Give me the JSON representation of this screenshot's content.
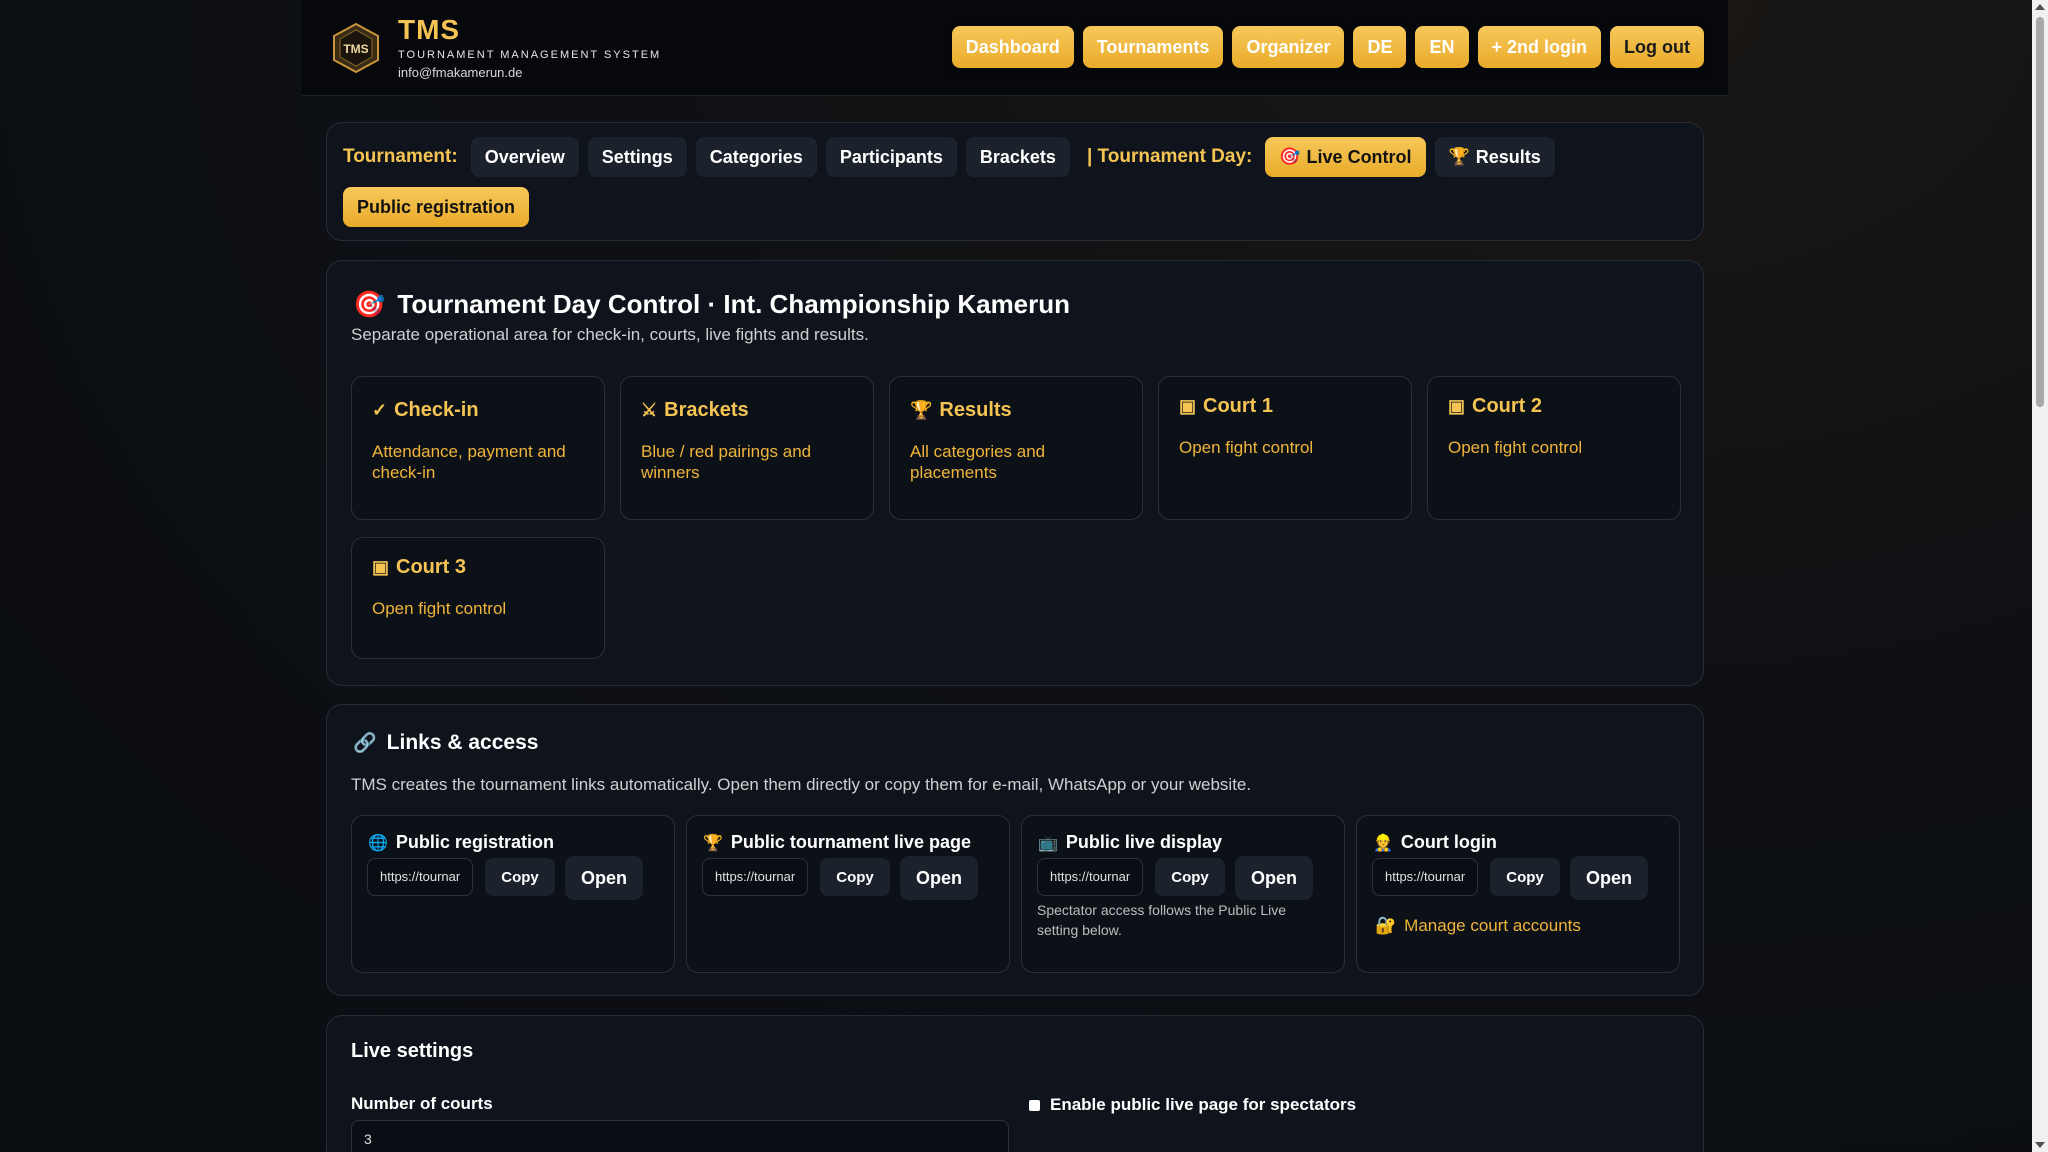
{
  "header": {
    "title": "TMS",
    "subtitle": "TOURNAMENT MANAGEMENT SYSTEM",
    "email": "info@fmakamerun.de",
    "logo_text": "TMS",
    "nav": [
      "Dashboard",
      "Tournaments",
      "Organizer",
      "DE",
      "EN",
      "+ 2nd login",
      "Log out"
    ]
  },
  "tabs": {
    "tournament_label": "Tournament:",
    "tournament_tabs": [
      "Overview",
      "Settings",
      "Categories",
      "Participants",
      "Brackets"
    ],
    "day_label": "| Tournament Day:",
    "live_control": "Live Control",
    "results": "Results",
    "public_registration": "Public registration"
  },
  "control": {
    "title": "Tournament Day Control · Int. Championship Kamerun",
    "subtitle": "Separate operational area for check-in, courts, live fights and results.",
    "cards": [
      {
        "icon": "check-icon",
        "title": "Check-in",
        "desc": "Attendance, payment and check-in"
      },
      {
        "icon": "swords-icon",
        "title": "Brackets",
        "desc": "Blue / red pairings and winners"
      },
      {
        "icon": "trophy-icon",
        "title": "Results",
        "desc": "All categories and placements"
      },
      {
        "icon": "court-icon",
        "title": "Court 1",
        "desc": "Open fight control"
      },
      {
        "icon": "court-icon",
        "title": "Court 2",
        "desc": "Open fight control"
      },
      {
        "icon": "court-icon",
        "title": "Court 3",
        "desc": "Open fight control"
      }
    ]
  },
  "links": {
    "title": "Links & access",
    "desc": "TMS creates the tournament links automatically. Open them directly or copy them for e-mail, WhatsApp or your website.",
    "copy_label": "Copy",
    "open_label": "Open",
    "cards": [
      {
        "icon": "globe-icon",
        "title": "Public registration",
        "url": "https://tournament"
      },
      {
        "icon": "trophy-icon",
        "title": "Public tournament live page",
        "url": "https://tournament"
      },
      {
        "icon": "tv-icon",
        "title": "Public live display",
        "url": "https://tournament",
        "note": "Spectator access follows the Public Live setting below."
      },
      {
        "icon": "referee-icon",
        "title": "Court login",
        "url": "https://tournament",
        "link": "Manage court accounts"
      }
    ]
  },
  "settings": {
    "title": "Live settings",
    "courts_label": "Number of courts",
    "courts_value": "3",
    "public_live_label": "Enable public live page for spectators",
    "public_live_checked": false
  },
  "colors": {
    "accent": "#f5c453",
    "button": "#eeb53a",
    "background": "#0a0d12"
  }
}
